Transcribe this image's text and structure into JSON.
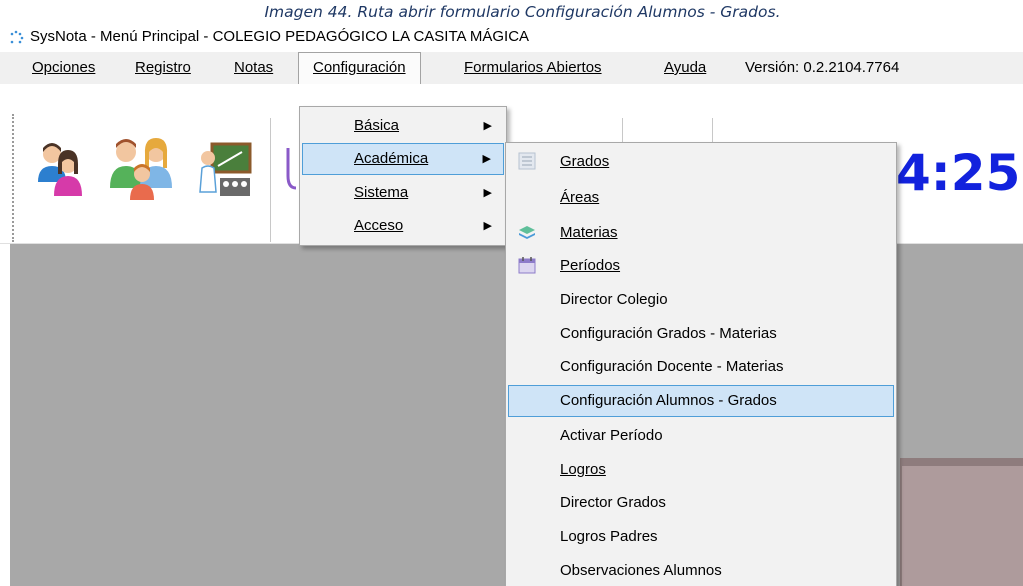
{
  "caption": "Imagen 44. Ruta abrir formulario Configuración Alumnos - Grados.",
  "window": {
    "title": "SysNota - Menú Principal - COLEGIO PEDAGÓGICO LA CASITA MÁGICA"
  },
  "menubar": {
    "items": [
      {
        "label": "Opciones",
        "accesskey": "O"
      },
      {
        "label": "Registro",
        "accesskey": "R"
      },
      {
        "label": "Notas",
        "accesskey": "N"
      },
      {
        "label": "Configuración",
        "accesskey": "C"
      },
      {
        "label": "Formularios Abiertos",
        "accesskey": "F"
      },
      {
        "label": "Ayuda",
        "accesskey": "A"
      }
    ],
    "version": "Versión: 0.2.2104.7764"
  },
  "toolbar": {
    "clock_text": "4:25",
    "icons": [
      "students-icon",
      "family-icon",
      "teacher-icon"
    ]
  },
  "config_menu": {
    "items": [
      {
        "label": "Básica"
      },
      {
        "label": "Académica"
      },
      {
        "label": "Sistema"
      },
      {
        "label": "Acceso"
      }
    ],
    "selected": "Académica"
  },
  "academic_menu": {
    "items": [
      {
        "label": "Grados",
        "icon": "grades-icon"
      },
      {
        "label": "Áreas"
      },
      {
        "label": "Materias",
        "icon": "layers-icon"
      },
      {
        "label": "Períodos",
        "icon": "calendar-icon"
      },
      {
        "label": "Director Colegio"
      },
      {
        "label": "Configuración Grados - Materias"
      },
      {
        "label": "Configuración Docente - Materias"
      },
      {
        "label": "Configuración Alumnos - Grados"
      },
      {
        "label": "Activar Período"
      },
      {
        "label": "Logros"
      },
      {
        "label": "Director Grados"
      },
      {
        "label": "Logros Padres"
      },
      {
        "label": "Observaciones Alumnos"
      }
    ],
    "selected": "Configuración Alumnos - Grados"
  },
  "colors": {
    "menu_highlight": "#cfe4f7",
    "menu_highlight_border": "#4f9ed8",
    "clock": "#1222dd",
    "workspace": "#a8a8a8"
  }
}
